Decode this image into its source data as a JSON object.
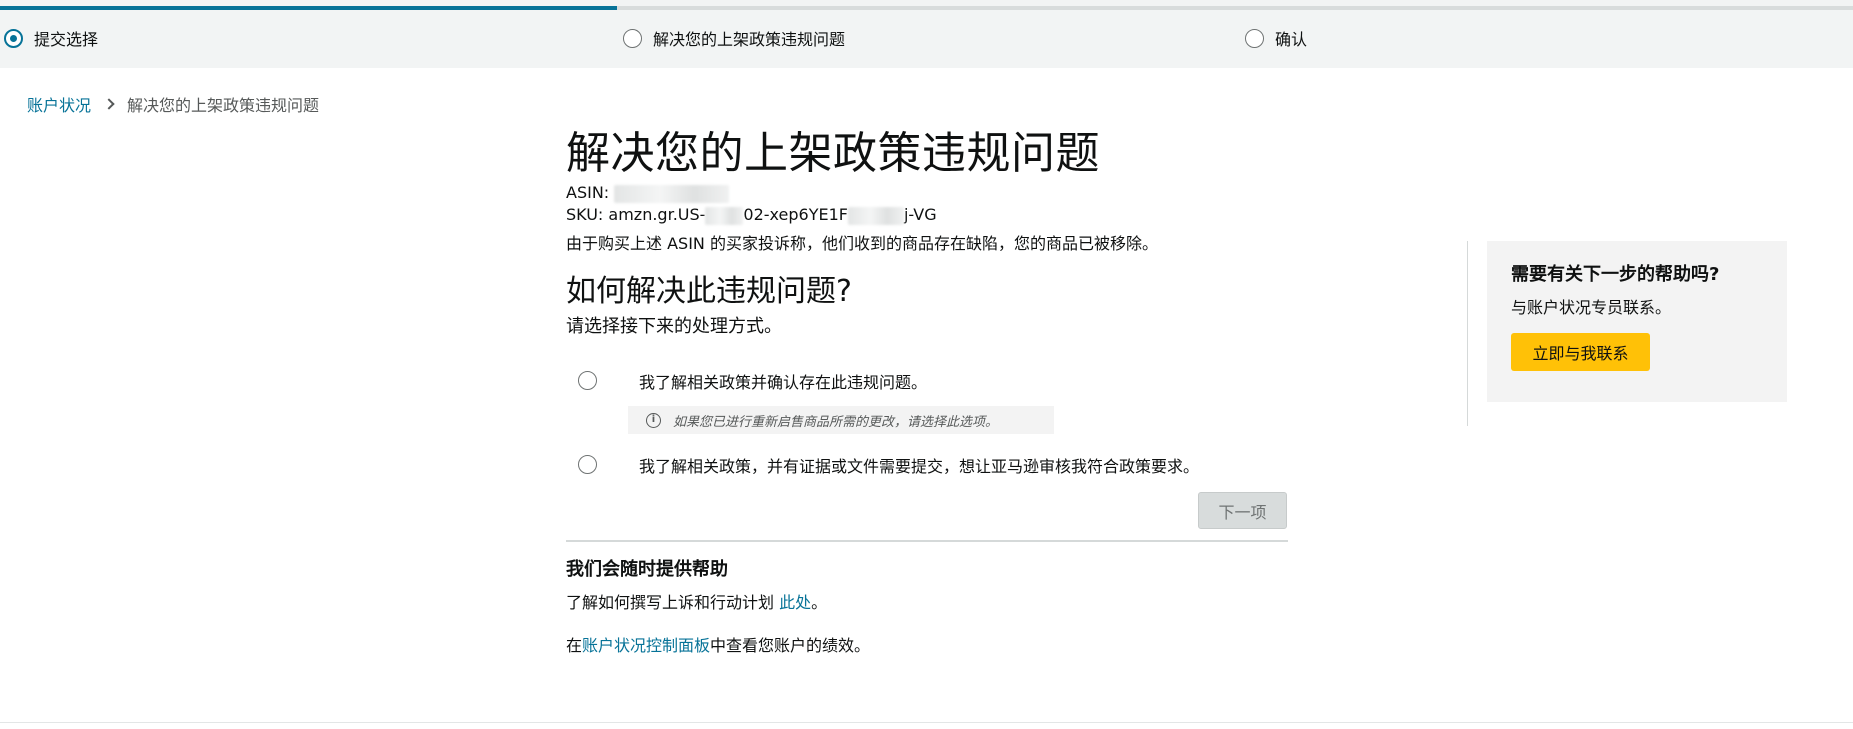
{
  "stepper": {
    "progress_fraction": 0.333,
    "steps": [
      {
        "label": "提交选择",
        "active": true
      },
      {
        "label": "解决您的上架政策违规问题",
        "active": false
      },
      {
        "label": "确认",
        "active": false
      }
    ]
  },
  "breadcrumb": {
    "root": "账户状况",
    "current": "解决您的上架政策违规问题"
  },
  "main": {
    "title": "解决您的上架政策违规问题",
    "asin_label": "ASIN:",
    "sku_prefix": "SKU: amzn.gr.US-",
    "sku_mid": "02-xep6YE1F",
    "sku_suffix": "j-VG",
    "description": "由于购买上述 ASIN 的买家投诉称，他们收到的商品存在缺陷，您的商品已被移除。",
    "question": "如何解决此违规问题?",
    "instruction": "请选择接下来的处理方式。",
    "options": [
      {
        "label": "我了解相关政策并确认存在此违规问题。",
        "selected": false
      },
      {
        "label": "我了解相关政策，并有证据或文件需要提交，想让亚马逊审核我符合政策要求。",
        "selected": false
      }
    ],
    "hint": "如果您已进行重新启售商品所需的更改，请选择此选项。",
    "next_button": "下一项"
  },
  "help": {
    "title": "我们会随时提供帮助",
    "line1_prefix": "了解如何撰写上诉和行动计划 ",
    "line1_link": "此处",
    "line1_suffix": "。",
    "line2_prefix": "在",
    "line2_link": "账户状况控制面板",
    "line2_suffix": "中查看您账户的绩效。"
  },
  "sidebar": {
    "title": "需要有关下一步的帮助吗?",
    "text": "与账户状况专员联系。",
    "button": "立即与我联系"
  },
  "colors": {
    "accent": "#077398",
    "button_yellow": "#ffc107",
    "disabled_button": "#d8dcdc"
  }
}
